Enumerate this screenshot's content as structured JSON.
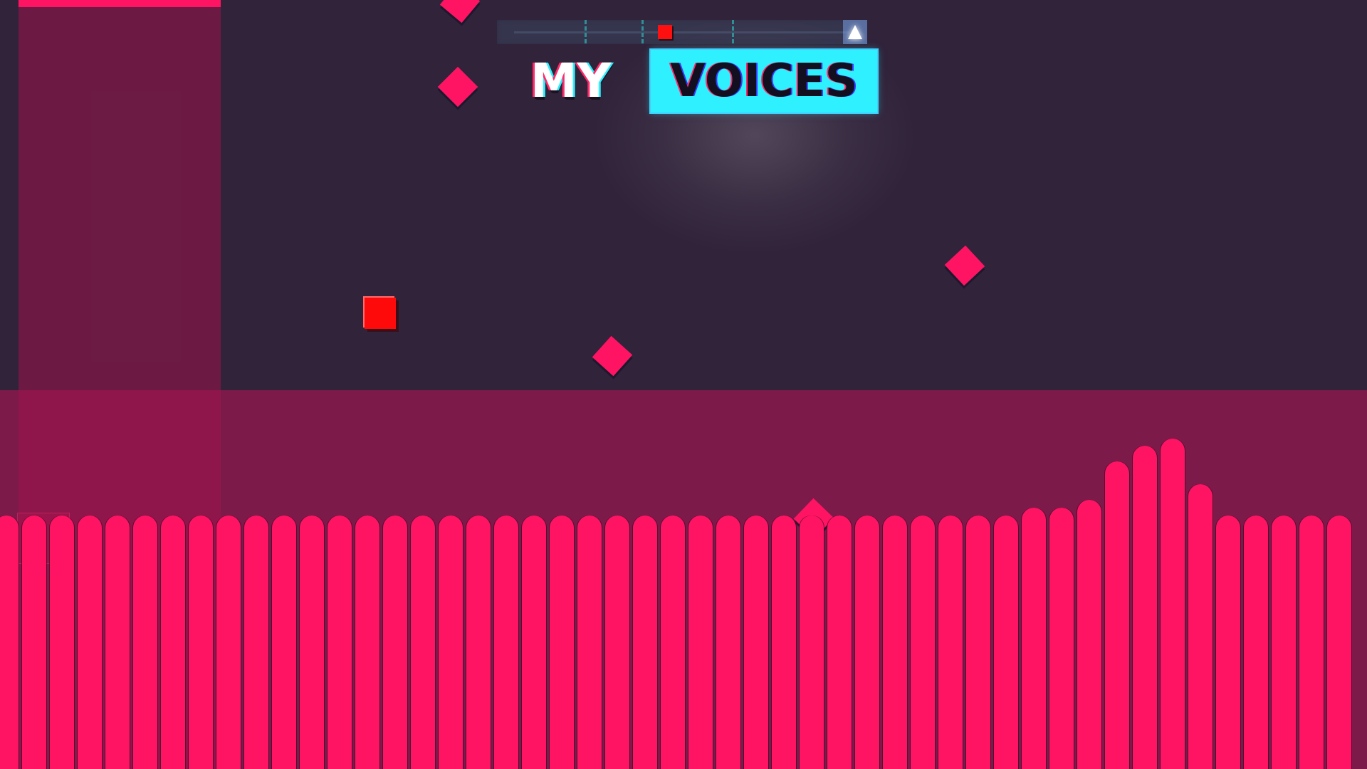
{
  "game": {
    "title_word_1": "MY",
    "title_word_2": "VOICES"
  },
  "progress": {
    "player_fraction": 0.45,
    "checkpoint_fractions": [
      0.21,
      0.38,
      0.65
    ],
    "goal_icon": "triangle-icon"
  },
  "colors": {
    "background": "#30233a",
    "floor": "#7c1a4a",
    "accent_pink": "#ff1463",
    "player_red": "#ff0a0a",
    "title_cyan": "#2ff0ff"
  },
  "visualizer": {
    "levels": [
      0.33,
      0.33,
      0.33,
      0.33,
      0.33,
      0.33,
      0.33,
      0.33,
      0.33,
      0.33,
      0.33,
      0.33,
      0.33,
      0.33,
      0.33,
      0.33,
      0.33,
      0.33,
      0.33,
      0.33,
      0.33,
      0.33,
      0.33,
      0.33,
      0.33,
      0.33,
      0.33,
      0.33,
      0.33,
      0.33,
      0.33,
      0.33,
      0.33,
      0.33,
      0.33,
      0.33,
      0.33,
      0.34,
      0.34,
      0.35,
      0.4,
      0.42,
      0.43,
      0.37,
      0.33,
      0.33,
      0.33,
      0.33,
      0.33
    ]
  }
}
